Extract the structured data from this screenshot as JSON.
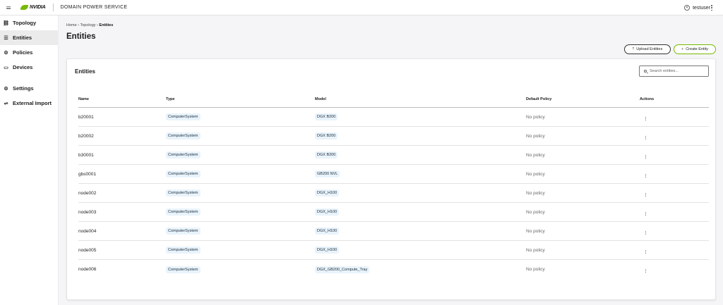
{
  "header": {
    "brand": "NVIDIA",
    "app_title": "DOMAIN POWER SERVICE",
    "username": "testuser"
  },
  "sidebar": {
    "items": [
      {
        "label": "Topology",
        "icon": "topology-icon",
        "glyph": "⛓"
      },
      {
        "label": "Entities",
        "icon": "server-icon",
        "glyph": "☰"
      },
      {
        "label": "Policies",
        "icon": "policy-icon",
        "glyph": "⚙"
      },
      {
        "label": "Devices",
        "icon": "device-icon",
        "glyph": "▭"
      },
      {
        "label": "Settings",
        "icon": "gear-icon",
        "glyph": "⚙"
      },
      {
        "label": "External Import",
        "icon": "import-icon",
        "glyph": "⇌"
      }
    ],
    "active": "Entities"
  },
  "breadcrumb": {
    "home": "Home",
    "sep1": "›",
    "topology": "Topology",
    "sep2": "›",
    "current": "Entities"
  },
  "page_title": "Entities",
  "toolbar": {
    "upload_label": "Upload Entities",
    "create_label": "Create Entity",
    "upload_glyph": "⤒",
    "create_glyph": "+"
  },
  "card": {
    "title": "Entities",
    "search_placeholder": "Search entities..."
  },
  "table": {
    "columns": [
      "Name",
      "Type",
      "Model",
      "Default Policy",
      "Actions"
    ],
    "rows": [
      {
        "name": "b20001",
        "type": "ComputerSystem",
        "model": "DGX B200",
        "policy": "No policy"
      },
      {
        "name": "b20002",
        "type": "ComputerSystem",
        "model": "DGX B200",
        "policy": "No policy"
      },
      {
        "name": "b30001",
        "type": "ComputerSystem",
        "model": "DGX B200",
        "policy": "No policy"
      },
      {
        "name": "gbs0001",
        "type": "ComputerSystem",
        "model": "GB200 NVL",
        "policy": "No policy"
      },
      {
        "name": "node002",
        "type": "ComputerSystem",
        "model": "DGX_H100",
        "policy": "No policy"
      },
      {
        "name": "node003",
        "type": "ComputerSystem",
        "model": "DGX_H100",
        "policy": "No policy"
      },
      {
        "name": "node004",
        "type": "ComputerSystem",
        "model": "DGX_H100",
        "policy": "No policy"
      },
      {
        "name": "node005",
        "type": "ComputerSystem",
        "model": "DGX_H100",
        "policy": "No policy"
      },
      {
        "name": "node006",
        "type": "ComputerSystem",
        "model": "DGX_GB200_Compute_Tray",
        "policy": "No policy"
      }
    ]
  },
  "colors": {
    "accent": "#76b900",
    "chip_bg": "#e8f3fb"
  }
}
